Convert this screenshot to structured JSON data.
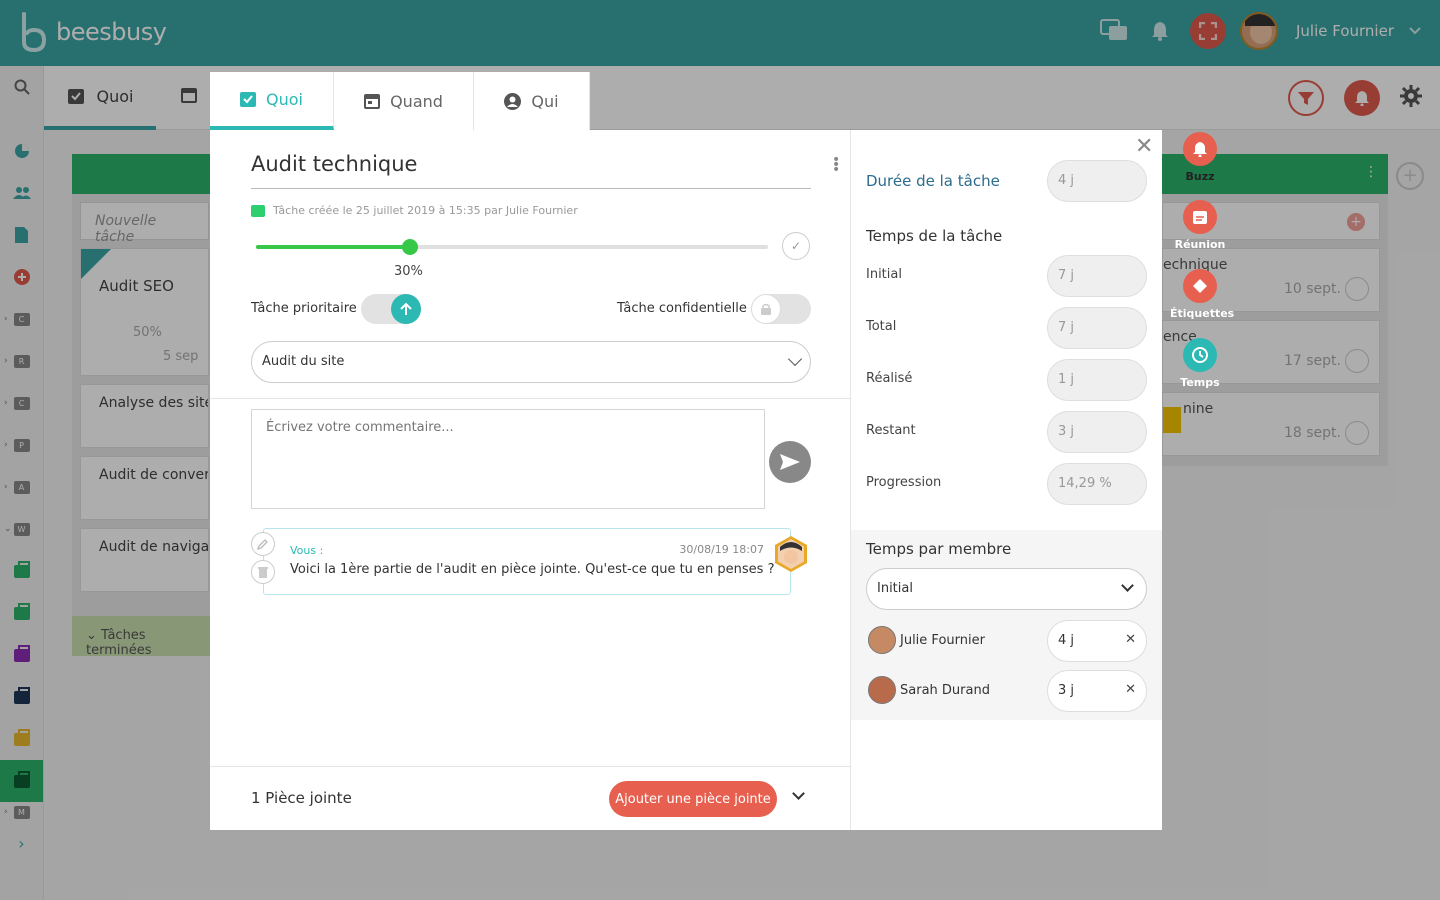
{
  "app": {
    "brand": "beesbusy",
    "user_name": "Julie Fournier"
  },
  "colors": {
    "teal": "#3aa6a4",
    "accent": "#2cb9b4",
    "red": "#e75f4f",
    "green": "#38c847"
  },
  "board": {
    "tab_quoi": "Quoi",
    "new_task_placeholder": "Nouvelle tâche",
    "cards": [
      {
        "title": "Audit SEO",
        "progress": "50%",
        "date": "5 sep"
      },
      {
        "title": "Analyse des site"
      },
      {
        "title": "Audit de convers"
      },
      {
        "title": "Audit de navigat"
      }
    ],
    "done_label": "Tâches terminées",
    "right_cards": [
      {
        "title": "echnique",
        "date": "10 sept."
      },
      {
        "title": "ence",
        "date": "17 sept."
      },
      {
        "title": "nine",
        "date": "18 sept."
      }
    ],
    "left_letters": [
      "C",
      "R",
      "C",
      "P",
      "A",
      "W",
      "M"
    ]
  },
  "modal": {
    "tabs": [
      "Quoi",
      "Quand",
      "Qui"
    ],
    "title": "Audit technique",
    "created": "Tâche créée le 25 juillet 2019 à 15:35 par Julie Fournier",
    "progress_value": 0.3,
    "progress_label": "30%",
    "priority_label": "Tâche prioritaire",
    "confidential_label": "Tâche confidentielle",
    "project": "Audit du site",
    "comment_placeholder": "Écrivez votre commentaire...",
    "message": {
      "author": "Vous :",
      "date": "30/08/19 18:07",
      "text": "Voici la 1ère partie de l'audit en pièce jointe. Qu'est-ce que tu en penses ?"
    },
    "attachments_count": "1 Pièce jointe",
    "add_attachment": "Ajouter une pièce jointe",
    "right": {
      "duration_label": "Durée de la tâche",
      "duration_value": "4 j",
      "time_title": "Temps de la tâche",
      "rows": [
        {
          "label": "Initial",
          "value": "7 j"
        },
        {
          "label": "Total",
          "value": "7 j"
        },
        {
          "label": "Réalisé",
          "value": "1 j"
        },
        {
          "label": "Restant",
          "value": "3 j"
        },
        {
          "label": "Progression",
          "value": "14,29 %"
        }
      ],
      "members_title": "Temps par membre",
      "members_select": "Initial",
      "members": [
        {
          "name": "Julie Fournier",
          "value": "4 j"
        },
        {
          "name": "Sarah Durand",
          "value": "3 j"
        }
      ]
    }
  },
  "floating_actions": [
    {
      "label": "Buzz",
      "color": "#e75f4f"
    },
    {
      "label": "Réunion",
      "color": "#e75f4f"
    },
    {
      "label": "Étiquettes",
      "color": "#e75f4f"
    },
    {
      "label": "Temps",
      "color": "#2cb9b4"
    }
  ]
}
